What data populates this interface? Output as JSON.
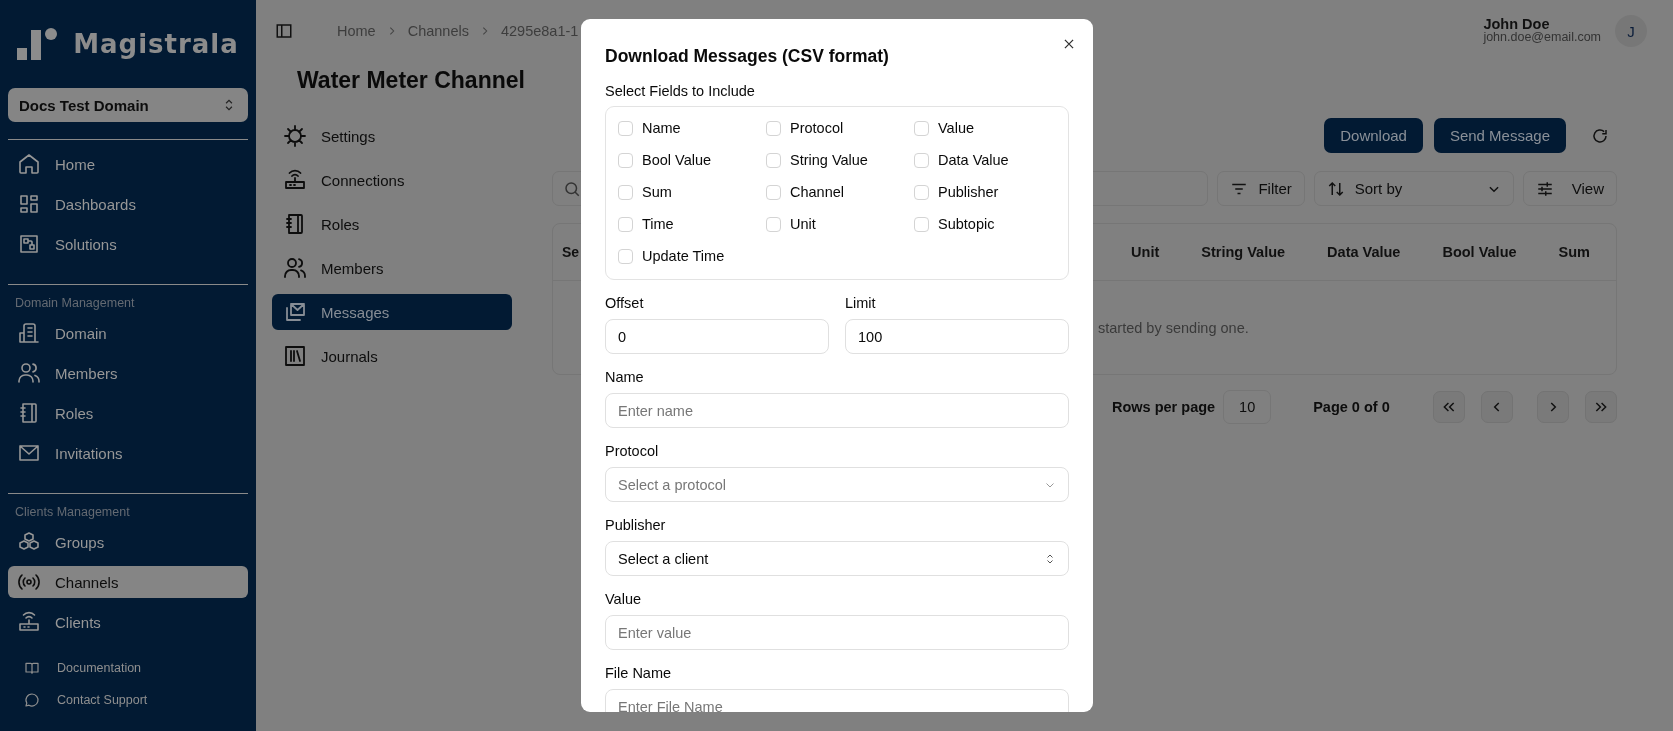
{
  "sidebar": {
    "logo": "Magistrala",
    "domain_selector": "Docs Test Domain",
    "sections": [
      {
        "items": [
          {
            "label": "Home",
            "selected": false
          },
          {
            "label": "Dashboards",
            "selected": false
          },
          {
            "label": "Solutions",
            "selected": false
          }
        ]
      },
      {
        "heading": "Domain Management",
        "items": [
          {
            "label": "Domain",
            "selected": false
          },
          {
            "label": "Members",
            "selected": false
          },
          {
            "label": "Roles",
            "selected": false
          },
          {
            "label": "Invitations",
            "selected": false
          }
        ]
      },
      {
        "heading": "Clients Management",
        "items": [
          {
            "label": "Groups",
            "selected": false
          },
          {
            "label": "Channels",
            "selected": true
          },
          {
            "label": "Clients",
            "selected": false
          }
        ]
      }
    ],
    "footer_links": [
      "Documentation",
      "Contact Support"
    ]
  },
  "breadcrumb": [
    "Home",
    "Channels",
    "4295e8a1-1"
  ],
  "user": {
    "name": "John Doe",
    "email": "john.doe@email.com",
    "avatar": "J"
  },
  "page_title": "Water Meter Channel",
  "subnav": [
    {
      "label": "Settings",
      "selected": false
    },
    {
      "label": "Connections",
      "selected": false
    },
    {
      "label": "Roles",
      "selected": false
    },
    {
      "label": "Members",
      "selected": false
    },
    {
      "label": "Messages",
      "selected": true
    },
    {
      "label": "Journals",
      "selected": false
    }
  ],
  "actions": [
    "Download",
    "Send Message"
  ],
  "toolbar": {
    "filter": "Filter",
    "sort": "Sort by",
    "view": "View"
  },
  "table": {
    "columns": [
      "Se",
      "Unit",
      "String Value",
      "Data Value",
      "Bool Value",
      "Sum"
    ],
    "empty_message": "started by sending one."
  },
  "pagination": {
    "rows_label": "Rows per page",
    "rows_value": "10",
    "page_info": "Page 0 of 0"
  },
  "dialog": {
    "title": "Download Messages (CSV format)",
    "fields_label": "Select Fields to Include",
    "fields": [
      {
        "label": "Name",
        "checked": false
      },
      {
        "label": "Protocol",
        "checked": false
      },
      {
        "label": "Value",
        "checked": false
      },
      {
        "label": "Bool Value",
        "checked": false
      },
      {
        "label": "String Value",
        "checked": false
      },
      {
        "label": "Data Value",
        "checked": false
      },
      {
        "label": "Sum",
        "checked": false
      },
      {
        "label": "Channel",
        "checked": false
      },
      {
        "label": "Publisher",
        "checked": false
      },
      {
        "label": "Time",
        "checked": false
      },
      {
        "label": "Unit",
        "checked": false
      },
      {
        "label": "Subtopic",
        "checked": false
      },
      {
        "label": "Update Time",
        "checked": false
      }
    ],
    "offset": {
      "label": "Offset",
      "value": "0"
    },
    "limit": {
      "label": "Limit",
      "value": "100"
    },
    "name": {
      "label": "Name",
      "placeholder": "Enter name"
    },
    "protocol": {
      "label": "Protocol",
      "placeholder": "Select a protocol"
    },
    "publisher": {
      "label": "Publisher",
      "value": "Select a client"
    },
    "value": {
      "label": "Value",
      "placeholder": "Enter value"
    },
    "file_name": {
      "label": "File Name",
      "placeholder": "Enter File Name"
    }
  }
}
